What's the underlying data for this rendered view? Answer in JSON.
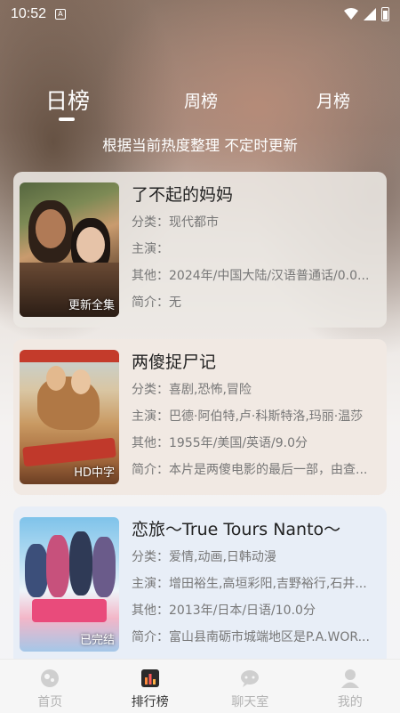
{
  "status_bar": {
    "time": "10:52",
    "notification_icon": "A"
  },
  "tabs": [
    {
      "label": "日榜",
      "selected": true
    },
    {
      "label": "周榜",
      "selected": false
    },
    {
      "label": "月榜",
      "selected": false
    }
  ],
  "subtitle": "根据当前热度整理 不定时更新",
  "items": [
    {
      "title": "了不起的妈妈",
      "category": "分类：现代都市",
      "cast": "主演：",
      "other": "其他：2024年/中国大陆/汉语普通话/0.0...",
      "intro": "简介：无",
      "badge": "更新全集"
    },
    {
      "title": "两傻捉尸记",
      "category": "分类：喜剧,恐怖,冒险",
      "cast": "主演：巴德·阿伯特,卢·科斯特洛,玛丽·温莎",
      "other": "其他：1955年/美国/英语/9.0分",
      "intro": "简介：本片是两傻电影的最后一部，由查...",
      "badge": "HD中字"
    },
    {
      "title": "恋旅～True Tours Nanto～",
      "category": "分类：爱情,动画,日韩动漫",
      "cast": "主演：增田裕生,高垣彩阳,吉野裕行,石井...",
      "other": "其他：2013年/日本/日语/10.0分",
      "intro": "简介：富山县南砺市城端地区是P.A.WOR...",
      "badge": "已完结"
    }
  ],
  "bottom_nav": [
    {
      "label": "首页",
      "icon": "home-icon",
      "active": false
    },
    {
      "label": "排行榜",
      "icon": "ranking-icon",
      "active": true
    },
    {
      "label": "聊天室",
      "icon": "chat-icon",
      "active": false
    },
    {
      "label": "我的",
      "icon": "profile-icon",
      "active": false
    }
  ]
}
